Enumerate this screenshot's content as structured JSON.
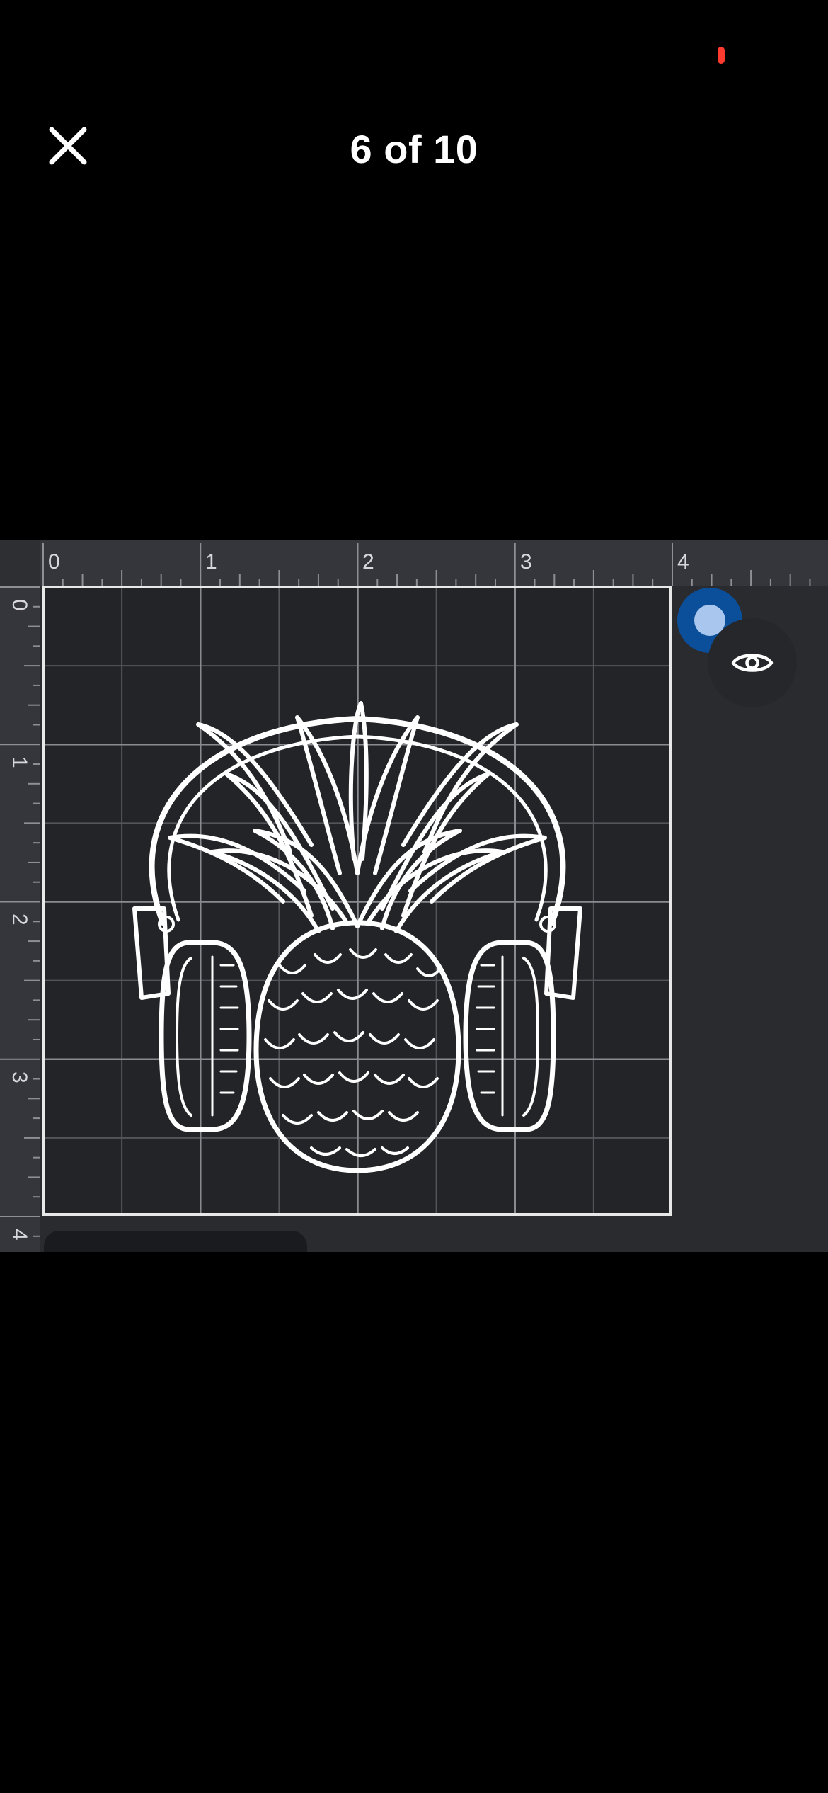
{
  "viewer": {
    "counter": "6 of 10"
  },
  "status_bar": {
    "indicator_color": "#ff3b30"
  },
  "icons": {
    "close": "close-icon",
    "visibility": "eye-icon",
    "selection_handle": "selection-handle"
  },
  "canvas": {
    "ruler_x_labels": [
      "0",
      "1",
      "2",
      "3",
      "4"
    ],
    "ruler_y_labels": [
      "0",
      "1",
      "2",
      "3",
      "4"
    ],
    "artwork": "pineapple-with-headphones"
  },
  "colors": {
    "background": "#000000",
    "canvas_bg": "#2a2b2f",
    "ruler_bg": "#35363b",
    "grid_line": "#5a5b60",
    "mat_border": "#e8e8e8",
    "handle_accent": "#0b4f9a"
  }
}
